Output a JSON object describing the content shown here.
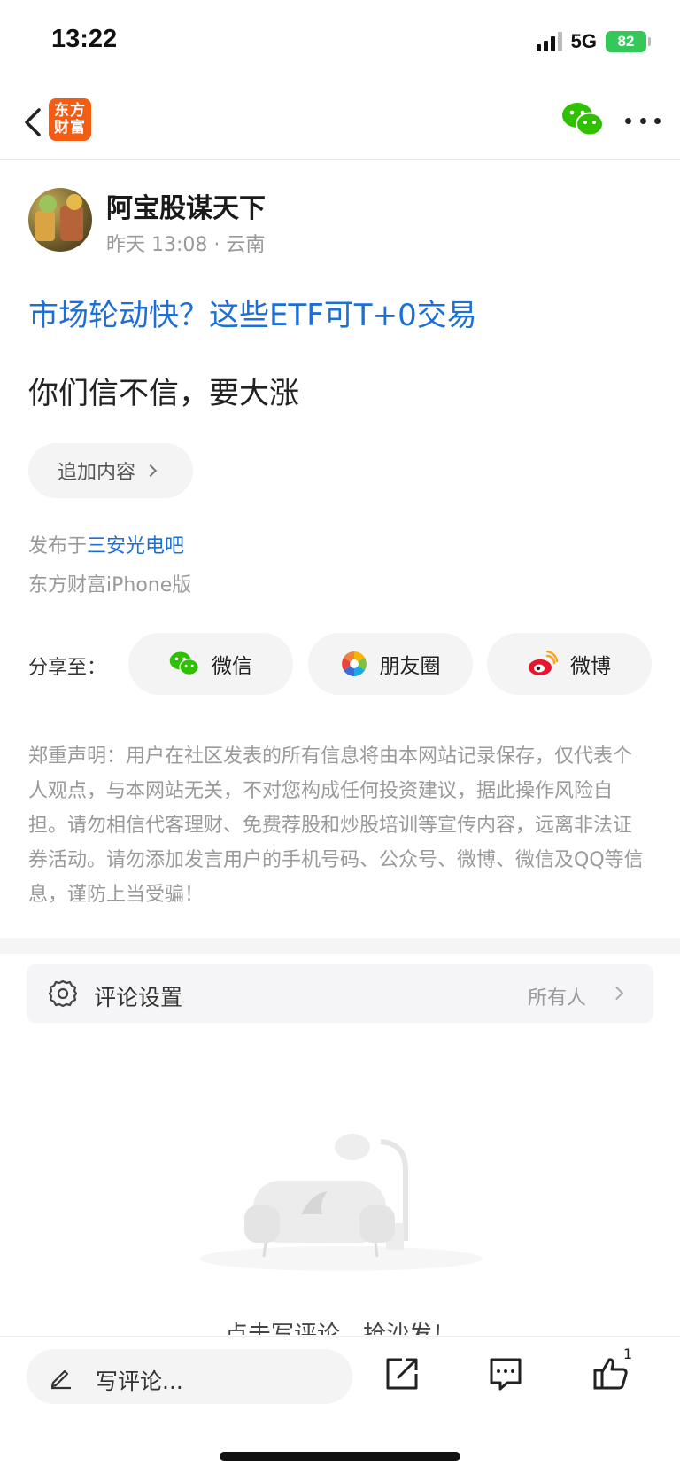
{
  "status_bar": {
    "time": "13:22",
    "network": "5G",
    "battery": "82"
  },
  "nav": {
    "logo_text": "东方\n财富",
    "back_icon": "chevron-left-icon",
    "wechat_icon": "wechat-icon",
    "more_icon": "more-icon"
  },
  "post": {
    "author": "阿宝股谋天下",
    "time": "昨天 13:08",
    "location": "云南",
    "ad_link": "市场轮动快？这些ETF可T+0交易",
    "body": "你们信不信，要大涨",
    "add_content": "追加内容",
    "posted_in_prefix": "发布于",
    "bar_name": "三安光电吧",
    "client": "东方财富iPhone版"
  },
  "share": {
    "label": "分享至：",
    "wechat": "微信",
    "moments": "朋友圈",
    "weibo": "微博"
  },
  "disclaimer": "郑重声明：用户在社区发表的所有信息将由本网站记录保存，仅代表个人观点，与本网站无关，不对您构成任何投资建议，据此操作风险自担。请勿相信代客理财、免费荐股和炒股培训等宣传内容，远离非法证券活动。请勿添加发言用户的手机号码、公众号、微博、微信及QQ等信息，谨防上当受骗！",
  "comment_settings": {
    "label": "评论设置",
    "value": "所有人"
  },
  "empty": {
    "text": "点击写评论，抢沙发！"
  },
  "bottom_bar": {
    "input_placeholder": "写评论...",
    "like_count": "1"
  },
  "colors": {
    "brand": "#f25c13",
    "link": "#1d6fd6",
    "wechat": "#2dc100",
    "battery": "#34c759"
  }
}
